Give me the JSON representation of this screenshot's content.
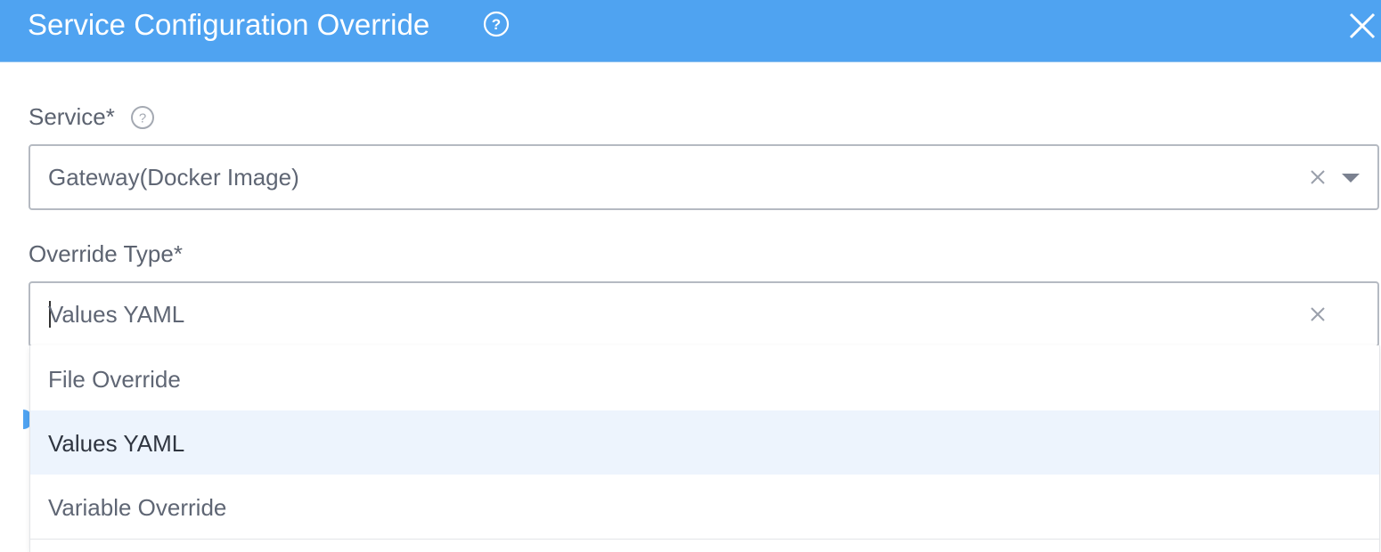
{
  "dialog": {
    "title": "Service Configuration Override",
    "accent_color": "#4fa3f1"
  },
  "service": {
    "label": "Service*",
    "value": "Gateway(Docker Image)"
  },
  "override_type": {
    "label": "Override Type*",
    "value": "Values YAML",
    "options": [
      {
        "label": "File Override",
        "selected": false
      },
      {
        "label": "Values YAML",
        "selected": true
      },
      {
        "label": "Variable Override",
        "selected": false
      }
    ]
  },
  "icons": {
    "help": "question-circle-icon",
    "close": "close-icon",
    "clear": "clear-x-icon",
    "dropdown": "chevron-down-icon"
  }
}
